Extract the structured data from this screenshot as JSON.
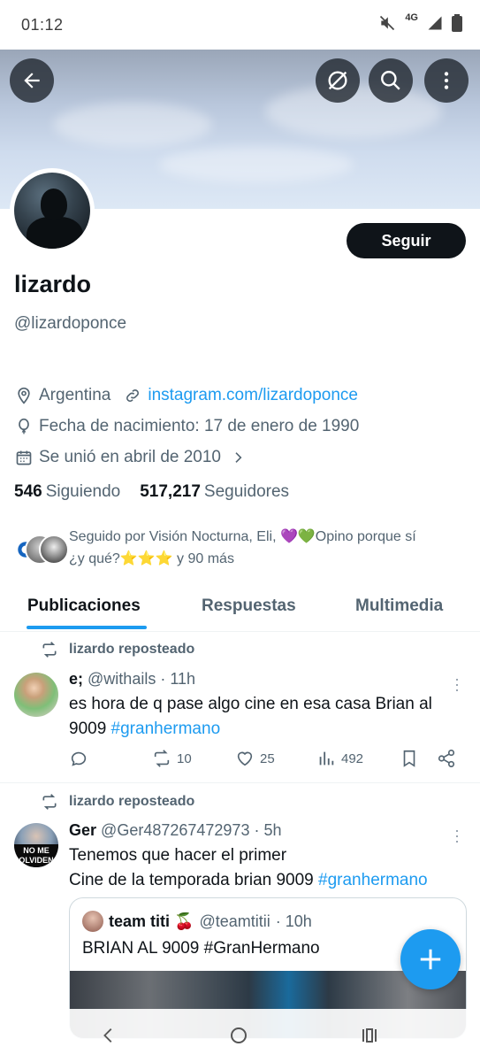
{
  "status_bar": {
    "time": "01:12",
    "network": "4G",
    "icons": [
      "mute-icon",
      "signal-icon",
      "battery-icon"
    ]
  },
  "header": {
    "buttons": [
      "back-arrow-icon",
      "grok-icon",
      "search-icon",
      "more-vertical-icon"
    ]
  },
  "profile": {
    "follow_label": "Seguir",
    "display_name": "lizardo",
    "handle": "@lizardoponce",
    "location": "Argentina",
    "website": "instagram.com/lizardoponce",
    "birthday": "Fecha de nacimiento: 17 de enero de 1990",
    "joined": "Se unió en abril de 2010",
    "following_count": "546",
    "following_label": "Siguiendo",
    "followers_count": "517,217",
    "followers_label": "Seguidores",
    "followed_by_line1": "Seguido por Visión Nocturna, Eli, 💜💚Opino porque sí",
    "followed_by_line2": "¿y qué?⭐⭐⭐ y 90 más"
  },
  "tabs": [
    {
      "label": "Publicaciones",
      "active": true
    },
    {
      "label": "Respuestas",
      "active": false
    },
    {
      "label": "Multimedia",
      "active": false
    }
  ],
  "posts": [
    {
      "repost_label": "lizardo reposteado",
      "author_name": "e;",
      "author_handle": "@withails",
      "time": "· 11h",
      "text_line1": "es hora de q pase algo cine en esa casa Brian al",
      "text_line2_plain": "9009 ",
      "hashtag": "#granhermano",
      "replies": "",
      "reposts": "10",
      "likes": "25",
      "views": "492"
    },
    {
      "repost_label": "lizardo reposteado",
      "author_name": "Ger",
      "author_handle": "@Ger487267472973",
      "time": "· 5h",
      "avatar_text_1": "NO ME",
      "avatar_text_2": "OLVIDEN",
      "text_line1": "Tenemos que hacer el primer",
      "text_line2_plain": "Cine de la temporada brian 9009 ",
      "hashtag": "#granhermano",
      "quote": {
        "author_name": "team titi 🍒",
        "author_handle": "@teamtitii",
        "time": "· 10h",
        "text": "BRIAN AL 9009 #GranHermano"
      }
    }
  ],
  "fab_icon": "plus-icon",
  "nav_bar": [
    "back-nav-icon",
    "home-nav-icon",
    "recents-nav-icon"
  ]
}
